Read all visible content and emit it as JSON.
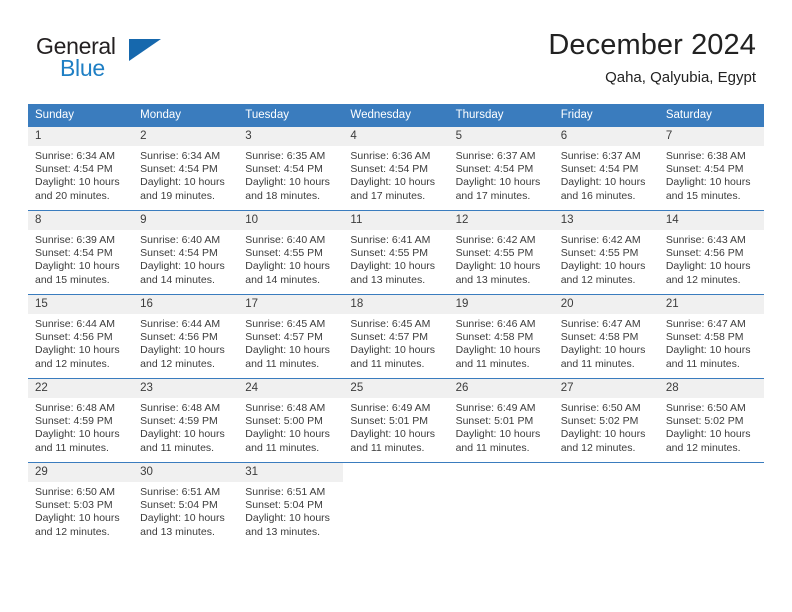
{
  "brand": {
    "name_part1": "General",
    "name_part2": "Blue",
    "accent_color": "#1f7fc4",
    "triangle_color": "#1668ad"
  },
  "header": {
    "title": "December 2024",
    "subtitle": "Qaha, Qalyubia, Egypt"
  },
  "calendar": {
    "header_color": "#3a7cbe",
    "daynum_background": "#f0f0f0",
    "weekdays": [
      "Sunday",
      "Monday",
      "Tuesday",
      "Wednesday",
      "Thursday",
      "Friday",
      "Saturday"
    ],
    "weeks": [
      [
        {
          "day": "1",
          "sunrise": "Sunrise: 6:34 AM",
          "sunset": "Sunset: 4:54 PM",
          "daylight_line1": "Daylight: 10 hours",
          "daylight_line2": "and 20 minutes."
        },
        {
          "day": "2",
          "sunrise": "Sunrise: 6:34 AM",
          "sunset": "Sunset: 4:54 PM",
          "daylight_line1": "Daylight: 10 hours",
          "daylight_line2": "and 19 minutes."
        },
        {
          "day": "3",
          "sunrise": "Sunrise: 6:35 AM",
          "sunset": "Sunset: 4:54 PM",
          "daylight_line1": "Daylight: 10 hours",
          "daylight_line2": "and 18 minutes."
        },
        {
          "day": "4",
          "sunrise": "Sunrise: 6:36 AM",
          "sunset": "Sunset: 4:54 PM",
          "daylight_line1": "Daylight: 10 hours",
          "daylight_line2": "and 17 minutes."
        },
        {
          "day": "5",
          "sunrise": "Sunrise: 6:37 AM",
          "sunset": "Sunset: 4:54 PM",
          "daylight_line1": "Daylight: 10 hours",
          "daylight_line2": "and 17 minutes."
        },
        {
          "day": "6",
          "sunrise": "Sunrise: 6:37 AM",
          "sunset": "Sunset: 4:54 PM",
          "daylight_line1": "Daylight: 10 hours",
          "daylight_line2": "and 16 minutes."
        },
        {
          "day": "7",
          "sunrise": "Sunrise: 6:38 AM",
          "sunset": "Sunset: 4:54 PM",
          "daylight_line1": "Daylight: 10 hours",
          "daylight_line2": "and 15 minutes."
        }
      ],
      [
        {
          "day": "8",
          "sunrise": "Sunrise: 6:39 AM",
          "sunset": "Sunset: 4:54 PM",
          "daylight_line1": "Daylight: 10 hours",
          "daylight_line2": "and 15 minutes."
        },
        {
          "day": "9",
          "sunrise": "Sunrise: 6:40 AM",
          "sunset": "Sunset: 4:54 PM",
          "daylight_line1": "Daylight: 10 hours",
          "daylight_line2": "and 14 minutes."
        },
        {
          "day": "10",
          "sunrise": "Sunrise: 6:40 AM",
          "sunset": "Sunset: 4:55 PM",
          "daylight_line1": "Daylight: 10 hours",
          "daylight_line2": "and 14 minutes."
        },
        {
          "day": "11",
          "sunrise": "Sunrise: 6:41 AM",
          "sunset": "Sunset: 4:55 PM",
          "daylight_line1": "Daylight: 10 hours",
          "daylight_line2": "and 13 minutes."
        },
        {
          "day": "12",
          "sunrise": "Sunrise: 6:42 AM",
          "sunset": "Sunset: 4:55 PM",
          "daylight_line1": "Daylight: 10 hours",
          "daylight_line2": "and 13 minutes."
        },
        {
          "day": "13",
          "sunrise": "Sunrise: 6:42 AM",
          "sunset": "Sunset: 4:55 PM",
          "daylight_line1": "Daylight: 10 hours",
          "daylight_line2": "and 12 minutes."
        },
        {
          "day": "14",
          "sunrise": "Sunrise: 6:43 AM",
          "sunset": "Sunset: 4:56 PM",
          "daylight_line1": "Daylight: 10 hours",
          "daylight_line2": "and 12 minutes."
        }
      ],
      [
        {
          "day": "15",
          "sunrise": "Sunrise: 6:44 AM",
          "sunset": "Sunset: 4:56 PM",
          "daylight_line1": "Daylight: 10 hours",
          "daylight_line2": "and 12 minutes."
        },
        {
          "day": "16",
          "sunrise": "Sunrise: 6:44 AM",
          "sunset": "Sunset: 4:56 PM",
          "daylight_line1": "Daylight: 10 hours",
          "daylight_line2": "and 12 minutes."
        },
        {
          "day": "17",
          "sunrise": "Sunrise: 6:45 AM",
          "sunset": "Sunset: 4:57 PM",
          "daylight_line1": "Daylight: 10 hours",
          "daylight_line2": "and 11 minutes."
        },
        {
          "day": "18",
          "sunrise": "Sunrise: 6:45 AM",
          "sunset": "Sunset: 4:57 PM",
          "daylight_line1": "Daylight: 10 hours",
          "daylight_line2": "and 11 minutes."
        },
        {
          "day": "19",
          "sunrise": "Sunrise: 6:46 AM",
          "sunset": "Sunset: 4:58 PM",
          "daylight_line1": "Daylight: 10 hours",
          "daylight_line2": "and 11 minutes."
        },
        {
          "day": "20",
          "sunrise": "Sunrise: 6:47 AM",
          "sunset": "Sunset: 4:58 PM",
          "daylight_line1": "Daylight: 10 hours",
          "daylight_line2": "and 11 minutes."
        },
        {
          "day": "21",
          "sunrise": "Sunrise: 6:47 AM",
          "sunset": "Sunset: 4:58 PM",
          "daylight_line1": "Daylight: 10 hours",
          "daylight_line2": "and 11 minutes."
        }
      ],
      [
        {
          "day": "22",
          "sunrise": "Sunrise: 6:48 AM",
          "sunset": "Sunset: 4:59 PM",
          "daylight_line1": "Daylight: 10 hours",
          "daylight_line2": "and 11 minutes."
        },
        {
          "day": "23",
          "sunrise": "Sunrise: 6:48 AM",
          "sunset": "Sunset: 4:59 PM",
          "daylight_line1": "Daylight: 10 hours",
          "daylight_line2": "and 11 minutes."
        },
        {
          "day": "24",
          "sunrise": "Sunrise: 6:48 AM",
          "sunset": "Sunset: 5:00 PM",
          "daylight_line1": "Daylight: 10 hours",
          "daylight_line2": "and 11 minutes."
        },
        {
          "day": "25",
          "sunrise": "Sunrise: 6:49 AM",
          "sunset": "Sunset: 5:01 PM",
          "daylight_line1": "Daylight: 10 hours",
          "daylight_line2": "and 11 minutes."
        },
        {
          "day": "26",
          "sunrise": "Sunrise: 6:49 AM",
          "sunset": "Sunset: 5:01 PM",
          "daylight_line1": "Daylight: 10 hours",
          "daylight_line2": "and 11 minutes."
        },
        {
          "day": "27",
          "sunrise": "Sunrise: 6:50 AM",
          "sunset": "Sunset: 5:02 PM",
          "daylight_line1": "Daylight: 10 hours",
          "daylight_line2": "and 12 minutes."
        },
        {
          "day": "28",
          "sunrise": "Sunrise: 6:50 AM",
          "sunset": "Sunset: 5:02 PM",
          "daylight_line1": "Daylight: 10 hours",
          "daylight_line2": "and 12 minutes."
        }
      ],
      [
        {
          "day": "29",
          "sunrise": "Sunrise: 6:50 AM",
          "sunset": "Sunset: 5:03 PM",
          "daylight_line1": "Daylight: 10 hours",
          "daylight_line2": "and 12 minutes."
        },
        {
          "day": "30",
          "sunrise": "Sunrise: 6:51 AM",
          "sunset": "Sunset: 5:04 PM",
          "daylight_line1": "Daylight: 10 hours",
          "daylight_line2": "and 13 minutes."
        },
        {
          "day": "31",
          "sunrise": "Sunrise: 6:51 AM",
          "sunset": "Sunset: 5:04 PM",
          "daylight_line1": "Daylight: 10 hours",
          "daylight_line2": "and 13 minutes."
        },
        {
          "day": "",
          "sunrise": "",
          "sunset": "",
          "daylight_line1": "",
          "daylight_line2": ""
        },
        {
          "day": "",
          "sunrise": "",
          "sunset": "",
          "daylight_line1": "",
          "daylight_line2": ""
        },
        {
          "day": "",
          "sunrise": "",
          "sunset": "",
          "daylight_line1": "",
          "daylight_line2": ""
        },
        {
          "day": "",
          "sunrise": "",
          "sunset": "",
          "daylight_line1": "",
          "daylight_line2": ""
        }
      ]
    ]
  }
}
